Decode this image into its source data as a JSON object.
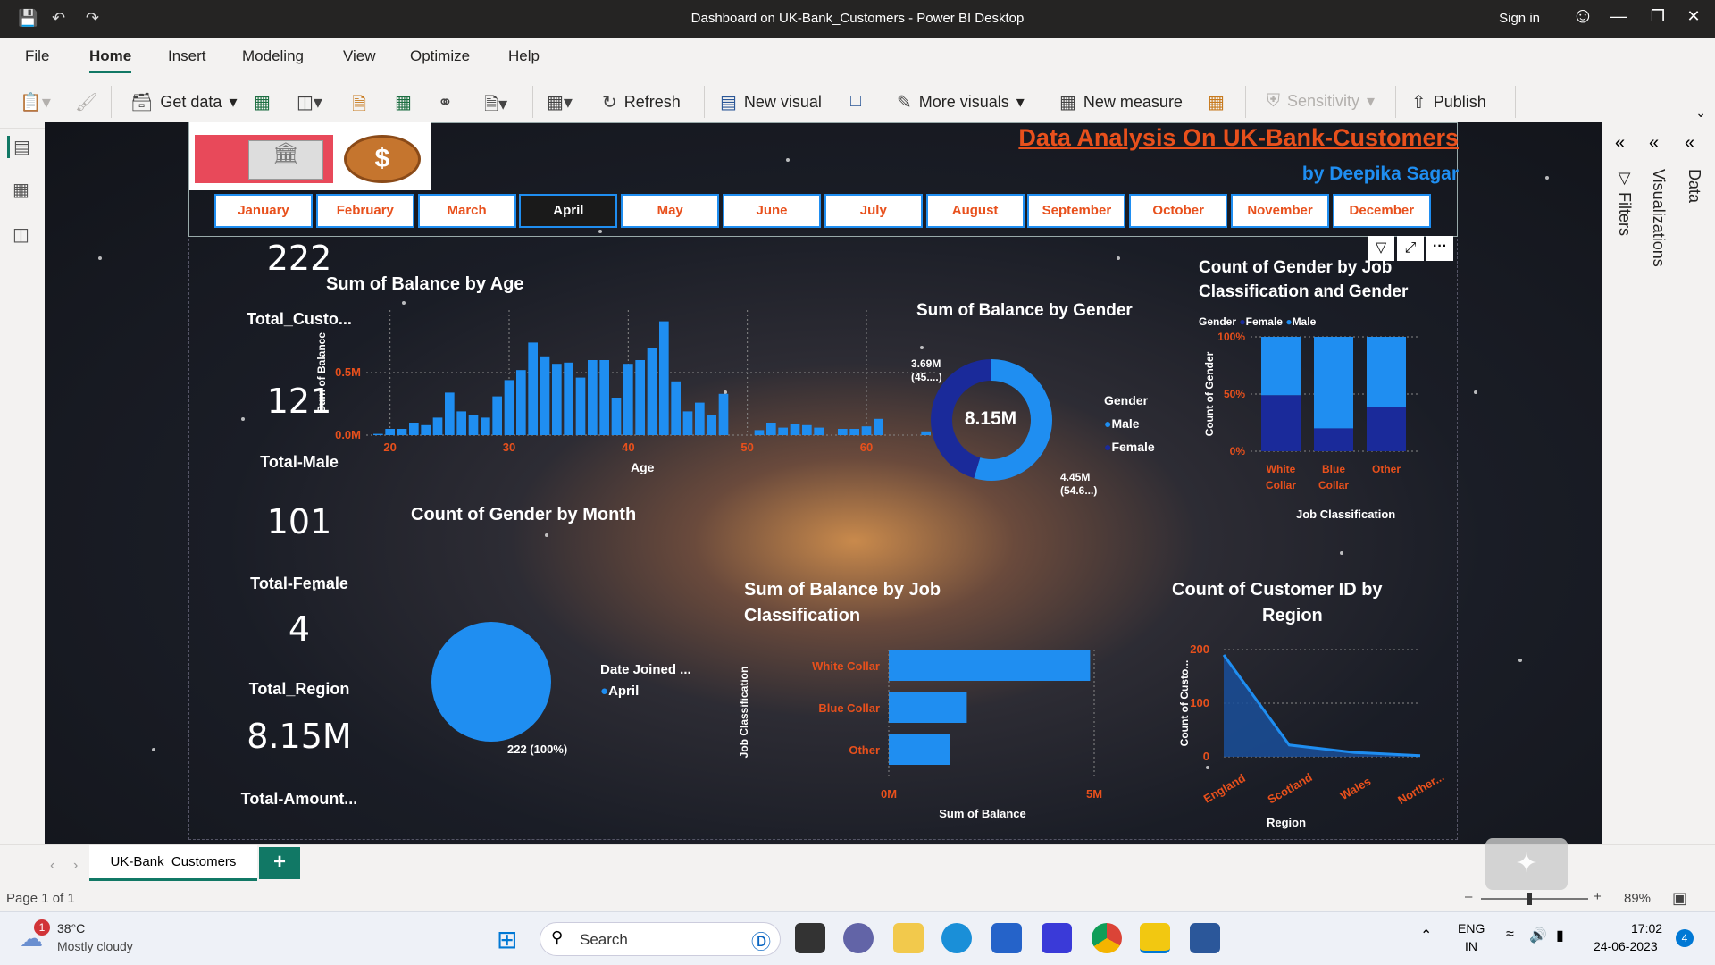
{
  "window": {
    "title": "Dashboard on UK-Bank_Customers - Power BI Desktop",
    "signin": "Sign in"
  },
  "menu": [
    "File",
    "Home",
    "Insert",
    "Modeling",
    "View",
    "Optimize",
    "Help"
  ],
  "ribbon": {
    "get_data": "Get data",
    "refresh": "Refresh",
    "new_visual": "New visual",
    "more_visuals": "More visuals",
    "new_measure": "New measure",
    "sensitivity": "Sensitivity",
    "publish": "Publish"
  },
  "report": {
    "title": "Data Analysis On UK-Bank-Customers",
    "author": "by Deepika Sagar",
    "months": [
      "January",
      "February",
      "March",
      "April",
      "May",
      "June",
      "July",
      "August",
      "September",
      "October",
      "November",
      "December"
    ],
    "selected_month": "April",
    "kpis": [
      {
        "value": "222",
        "label": "Total_Custo..."
      },
      {
        "value": "121",
        "label": "Total-Male"
      },
      {
        "value": "101",
        "label": "Total-Female"
      },
      {
        "value": "4",
        "label": "Total_Region"
      },
      {
        "value": "8.15M",
        "label": "Total-Amount..."
      }
    ]
  },
  "charts": {
    "age": {
      "title": "Sum of Balance by Age",
      "xlabel": "Age",
      "ylabel": "Sum of Balance",
      "yticks": [
        "0.5M",
        "0.0M"
      ],
      "xticks": [
        "20",
        "30",
        "40",
        "50",
        "60"
      ]
    },
    "gender": {
      "title": "Sum of Balance by Gender",
      "center": "8.15M",
      "legend_title": "Gender",
      "legend": [
        "Male",
        "Female"
      ],
      "label_female": "3.69M",
      "label_female_pct": "(45....)",
      "label_male": "4.45M",
      "label_male_pct": "(54.6...)"
    },
    "jobgender": {
      "title1": "Count of Gender by Job",
      "title2": "Classification and Gender",
      "legend_title": "Gender",
      "legend": [
        "Female",
        "Male"
      ],
      "yticks": [
        "100%",
        "50%",
        "0%"
      ],
      "ylabel": "Count of Gender",
      "cats": [
        [
          "White",
          "Collar"
        ],
        [
          "Blue",
          "Collar"
        ],
        [
          "Other",
          ""
        ]
      ],
      "xlabel": "Job Classification"
    },
    "month": {
      "title": "Count of Gender by Month",
      "legend_title": "Date Joined ...",
      "legend": [
        "April"
      ],
      "label": "222 (100%)"
    },
    "job": {
      "title1": "Sum of Balance by Job",
      "title2": "Classification",
      "cats": [
        "White Collar",
        "Blue Collar",
        "Other"
      ],
      "xticks": [
        "0M",
        "5M"
      ],
      "xlabel": "Sum of Balance",
      "ylabel": "Job Classification"
    },
    "region": {
      "title1": "Count of Customer ID by",
      "title2": "Region",
      "yticks": [
        "200",
        "100",
        "0"
      ],
      "cats": [
        "England",
        "Scotland",
        "Wales",
        "Norther..."
      ],
      "xlabel": "Region",
      "ylabel": "Count of Custo..."
    }
  },
  "chart_data": [
    {
      "type": "bar",
      "title": "Sum of Balance by Age",
      "xlabel": "Age",
      "ylabel": "Sum of Balance",
      "x": [
        19,
        20,
        21,
        22,
        23,
        24,
        25,
        26,
        27,
        28,
        29,
        30,
        31,
        32,
        33,
        34,
        35,
        36,
        37,
        38,
        39,
        40,
        41,
        42,
        43,
        44,
        45,
        46,
        47,
        48,
        49,
        50,
        51,
        52,
        53,
        54,
        55,
        56,
        57,
        58,
        59,
        60,
        61,
        62,
        63,
        64,
        65
      ],
      "values": [
        0.01,
        0.05,
        0.05,
        0.1,
        0.08,
        0.14,
        0.34,
        0.19,
        0.16,
        0.14,
        0.31,
        0.44,
        0.52,
        0.74,
        0.63,
        0.57,
        0.58,
        0.46,
        0.6,
        0.6,
        0.3,
        0.57,
        0.6,
        0.7,
        0.91,
        0.43,
        0.19,
        0.26,
        0.16,
        0.33,
        0.0,
        0.0,
        0.04,
        0.1,
        0.06,
        0.09,
        0.08,
        0.06,
        0.0,
        0.05,
        0.05,
        0.07,
        0.13,
        0.0,
        0.0,
        0.0,
        0.03
      ],
      "ylim": [
        0,
        1.0
      ]
    },
    {
      "type": "pie",
      "title": "Sum of Balance by Gender",
      "categories": [
        "Male",
        "Female"
      ],
      "values": [
        4.45,
        3.69
      ]
    },
    {
      "type": "bar",
      "title": "Count of Gender by Job Classification and Gender",
      "categories": [
        "White Collar",
        "Blue Collar",
        "Other"
      ],
      "series": [
        {
          "name": "Female",
          "values": [
            49,
            20,
            39
          ]
        },
        {
          "name": "Male",
          "values": [
            51,
            80,
            61
          ]
        }
      ],
      "ylim": [
        0,
        100
      ]
    },
    {
      "type": "pie",
      "title": "Count of Gender by Month",
      "categories": [
        "April"
      ],
      "values": [
        222
      ]
    },
    {
      "type": "bar",
      "title": "Sum of Balance by Job Classification",
      "categories": [
        "White Collar",
        "Blue Collar",
        "Other"
      ],
      "values": [
        4.9,
        1.9,
        1.5
      ],
      "xlim": [
        0,
        5
      ]
    },
    {
      "type": "area",
      "title": "Count of Customer ID by Region",
      "categories": [
        "England",
        "Scotland",
        "Wales",
        "Norther..."
      ],
      "values": [
        190,
        22,
        8,
        2
      ],
      "ylim": [
        0,
        200
      ]
    }
  ],
  "pane_labels": {
    "filters": "Filters",
    "visualizations": "Visualizations",
    "data": "Data"
  },
  "tabs": {
    "page": "UK-Bank_Customers",
    "add": "+"
  },
  "status": {
    "page": "Page 1 of 1",
    "zoom": "89%"
  },
  "taskbar": {
    "temp": "38°C",
    "weather": "Mostly cloudy",
    "search": "Search",
    "lang1": "ENG",
    "lang2": "IN",
    "time": "17:02",
    "date": "24-06-2023",
    "badge": "4",
    "weather_badge": "1"
  },
  "colors": {
    "accent": "#117865",
    "blue": "#1f8ef1",
    "darkblue": "#1a2a9a",
    "orange": "#e8501c"
  }
}
